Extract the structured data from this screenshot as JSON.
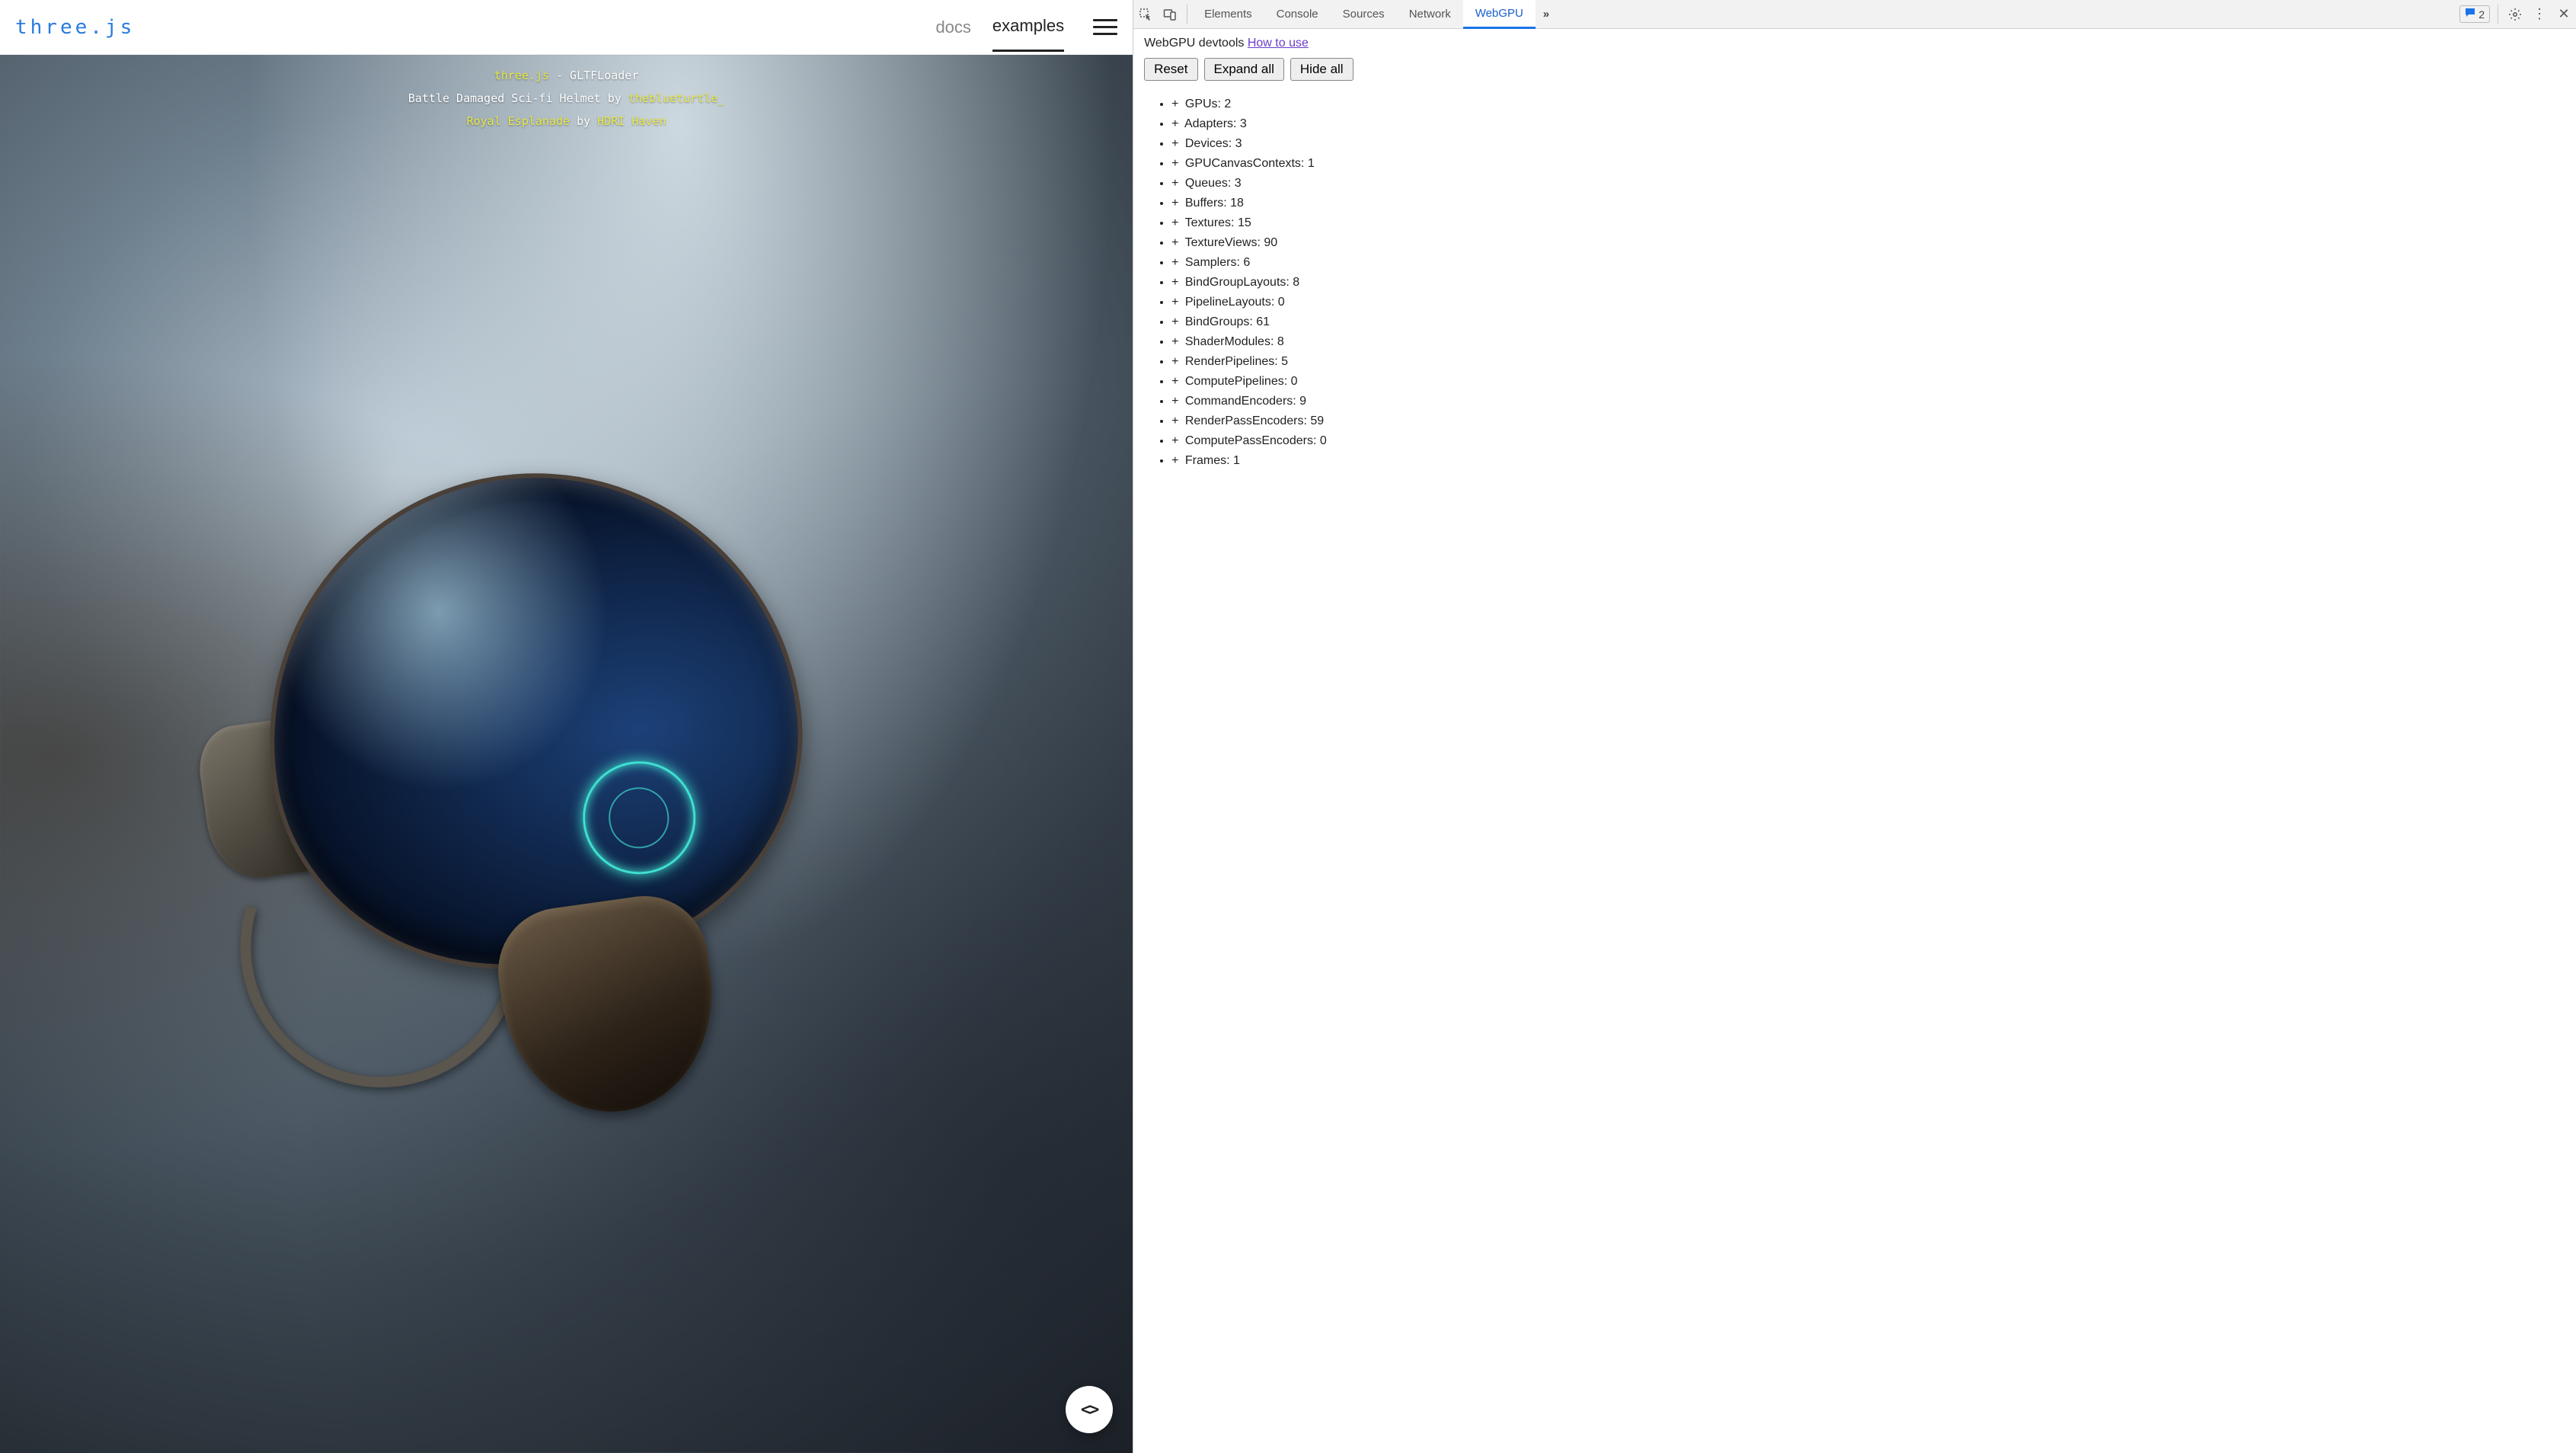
{
  "left": {
    "logo": "three.js",
    "nav": {
      "docs": "docs",
      "examples": "examples"
    },
    "overlay": {
      "line1_link": "three.js",
      "line1_rest": " - GLTFLoader",
      "line2_pre": "Battle Damaged Sci-fi Helmet by ",
      "line2_link": "theblueturtle_",
      "line3_link1": "Royal Esplanade",
      "line3_mid": " by ",
      "line3_link2": "HDRI Haven"
    },
    "source_btn": "<>"
  },
  "devtools": {
    "tabs": {
      "elements": "Elements",
      "console": "Console",
      "sources": "Sources",
      "network": "Network",
      "webgpu": "WebGPU",
      "overflow": "»"
    },
    "issue_count": "2",
    "panel": {
      "intro_text": "WebGPU devtools ",
      "intro_link": "How to use",
      "buttons": {
        "reset": "Reset",
        "expand": "Expand all",
        "hide": "Hide all"
      },
      "stats": [
        {
          "label": "GPUs",
          "value": 2
        },
        {
          "label": "Adapters",
          "value": 3
        },
        {
          "label": "Devices",
          "value": 3
        },
        {
          "label": "GPUCanvasContexts",
          "value": 1
        },
        {
          "label": "Queues",
          "value": 3
        },
        {
          "label": "Buffers",
          "value": 18
        },
        {
          "label": "Textures",
          "value": 15
        },
        {
          "label": "TextureViews",
          "value": 90
        },
        {
          "label": "Samplers",
          "value": 6
        },
        {
          "label": "BindGroupLayouts",
          "value": 8
        },
        {
          "label": "PipelineLayouts",
          "value": 0
        },
        {
          "label": "BindGroups",
          "value": 61
        },
        {
          "label": "ShaderModules",
          "value": 8
        },
        {
          "label": "RenderPipelines",
          "value": 5
        },
        {
          "label": "ComputePipelines",
          "value": 0
        },
        {
          "label": "CommandEncoders",
          "value": 9
        },
        {
          "label": "RenderPassEncoders",
          "value": 59
        },
        {
          "label": "ComputePassEncoders",
          "value": 0
        },
        {
          "label": "Frames",
          "value": 1
        }
      ]
    }
  }
}
